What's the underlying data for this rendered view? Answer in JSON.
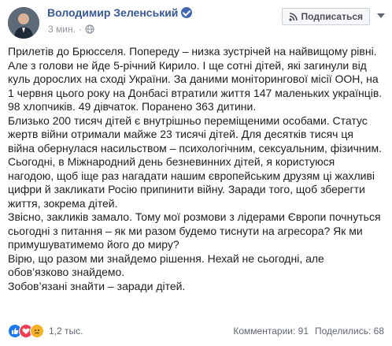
{
  "post": {
    "author": "Володимир Зеленський",
    "time": "3 мин.",
    "subscribe_label": "Подписаться",
    "paragraphs": [
      "Прилетів до Брюсселя. Попереду – низка зустрічей на найвищому рівні.\nАле з голови не йде 5-річний Кирило. І ще сотні дітей, які загинули від\nкуль дорослих на сході України. За даними моніторингової місії ООН, на\n1 червня цього року на Донбасі втратили життя 147 маленьких українців.\n98 хлопчиків. 49 дівчаток. Поранено 363 дитини.",
      "Близько 200 тисяч дітей є внутрішньо переміщеними особами. Статус\nжертв війни отримали майже 23 тисячі дітей. Для десятків тисяч ця\nвійна обернулася насильством – психологічним, сексуальним, фізичним.",
      "Сьогодні, в Міжнародний день безневинних дітей, я користуюся\nнагодою, щоб іще раз нагадати нашим європейським друзям ці жахливі\nцифри й закликати Росію припинити війну. Заради того, щоб зберегти\nжиття, зокрема дітей.",
      "Звісно, закликів замало. Тому мої розмови з лідерами Європи почнуться\nсьогодні з питання – як ми разом будемо тиснути на агресора? Як ми\nпримушуватимемо його до миру?",
      "Вірю, що разом ми знайдемо рішення. Нехай не сьогодні, але\nобов’язково знайдемо.",
      "Зобов’язані знайти – заради дітей."
    ]
  },
  "footer": {
    "reactions_count": "1,2 тыс.",
    "comments": "Комментарии: 91",
    "shares": "Поделились: 68"
  },
  "icons": {
    "verified": "verified-badge-icon",
    "globe": "globe-icon",
    "rss": "rss-icon",
    "more": "chevron-down-icon",
    "like": "like-reaction-icon",
    "love": "love-reaction-icon",
    "sad": "sad-reaction-icon"
  },
  "colors": {
    "author": "#385898",
    "verified": "#4267b2",
    "like": "#1877f2",
    "love": "#f33e58",
    "sad": "#f7b125"
  }
}
